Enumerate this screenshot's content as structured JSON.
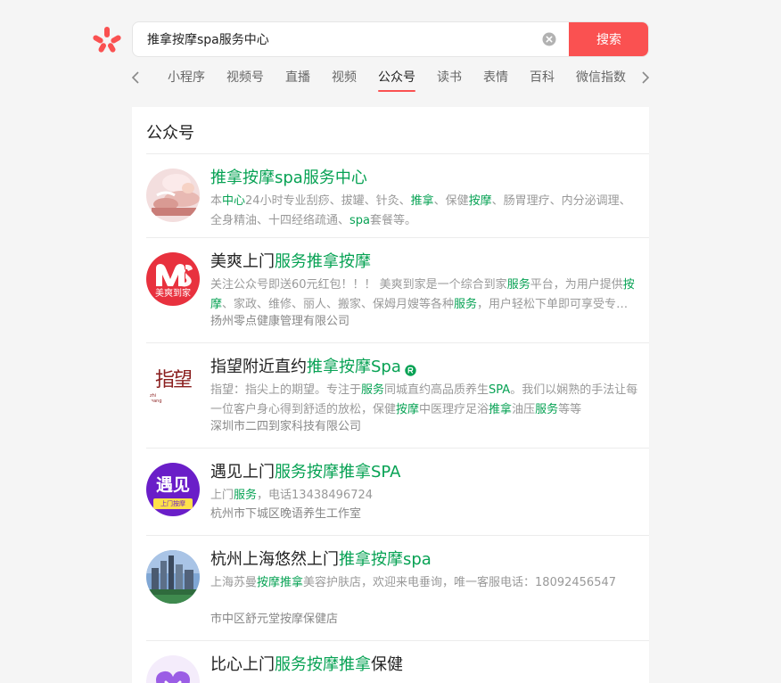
{
  "search": {
    "query": "推拿按摩spa服务中心",
    "button_label": "搜索"
  },
  "colors": {
    "brand": "#fa5151",
    "highlight": "#07a254",
    "tab_active_underline": "#fa5151"
  },
  "tabs": [
    {
      "label": "小程序"
    },
    {
      "label": "视频号"
    },
    {
      "label": "直播"
    },
    {
      "label": "视频"
    },
    {
      "label": "公众号",
      "active": true
    },
    {
      "label": "读书"
    },
    {
      "label": "表情"
    },
    {
      "label": "百科"
    },
    {
      "label": "微信指数"
    }
  ],
  "section": {
    "heading": "公众号"
  },
  "accounts": [
    {
      "avatar": "massage-photo",
      "verified": false,
      "title": [
        {
          "t": "推拿按摩spa服务中心",
          "h": true
        }
      ],
      "desc": [
        {
          "t": "本"
        },
        {
          "t": "中心",
          "h": true
        },
        {
          "t": "24小时专业刮痧、拔罐、针灸、"
        },
        {
          "t": "推拿",
          "h": true
        },
        {
          "t": "、保健"
        },
        {
          "t": "按摩",
          "h": true
        },
        {
          "t": "、肠胃理疗、内分泌调理、全身精油、十四经络疏通、"
        },
        {
          "t": "spa",
          "h": true
        },
        {
          "t": "套餐等。"
        }
      ],
      "company": ""
    },
    {
      "avatar": "ms-logo",
      "avatar_text": "美爽到家",
      "verified": false,
      "title": [
        {
          "t": "美爽上门"
        },
        {
          "t": "服务推拿按摩",
          "h": true
        }
      ],
      "desc": [
        {
          "t": "关注公众号即送60元红包！！！ 美爽到家是一个综合到家"
        },
        {
          "t": "服务",
          "h": true
        },
        {
          "t": "平台，为用户提供"
        },
        {
          "t": "按摩",
          "h": true
        },
        {
          "t": "、家政、维修、丽人、搬家、保姆月嫂等各种"
        },
        {
          "t": "服务",
          "h": true
        },
        {
          "t": "，用户轻松下单即可享受专业上门服务。"
        }
      ],
      "company": "扬州零点健康管理有限公司"
    },
    {
      "avatar": "zhiwang-logo",
      "avatar_text": "指望",
      "avatar_subtext": "zhi wang",
      "verified": true,
      "title": [
        {
          "t": "指望附近直约"
        },
        {
          "t": "推拿按摩Spa",
          "h": true
        }
      ],
      "desc": [
        {
          "t": "指望：指尖上的期望。专注于"
        },
        {
          "t": "服务",
          "h": true
        },
        {
          "t": "同城直约高品质养生"
        },
        {
          "t": "SPA",
          "h": true
        },
        {
          "t": "。我们以娴熟的手法让每一位客户身心得到舒适的放松，保健"
        },
        {
          "t": "按摩",
          "h": true
        },
        {
          "t": "中医理疗足浴"
        },
        {
          "t": "推拿",
          "h": true
        },
        {
          "t": "油压"
        },
        {
          "t": "服务",
          "h": true
        },
        {
          "t": "等等"
        }
      ],
      "company": "深圳市二四到家科技有限公司"
    },
    {
      "avatar": "yujian-logo",
      "avatar_text": "遇见",
      "avatar_subtext": "上门按摩",
      "verified": false,
      "title": [
        {
          "t": "遇见上门"
        },
        {
          "t": "服务按摩推拿SPA",
          "h": true
        }
      ],
      "desc": [
        {
          "t": "上门"
        },
        {
          "t": "服务",
          "h": true
        },
        {
          "t": "，电话13438496724"
        }
      ],
      "company": "杭州市下城区晚语养生工作室"
    },
    {
      "avatar": "city-photo",
      "verified": false,
      "title": [
        {
          "t": "杭州上海悠然上门"
        },
        {
          "t": "推拿按摩spa",
          "h": true
        }
      ],
      "desc": [
        {
          "t": "上海苏曼"
        },
        {
          "t": "按摩推拿",
          "h": true
        },
        {
          "t": "美容护肤店，欢迎来电垂询，唯一客服电话：18092456547"
        }
      ],
      "company": "市中区舒元堂按摩保健店"
    },
    {
      "avatar": "bixin-logo",
      "verified": false,
      "title": [
        {
          "t": "比心上门"
        },
        {
          "t": "服务按摩推拿",
          "h": true
        },
        {
          "t": "保健"
        }
      ],
      "desc": [],
      "company": ""
    }
  ]
}
